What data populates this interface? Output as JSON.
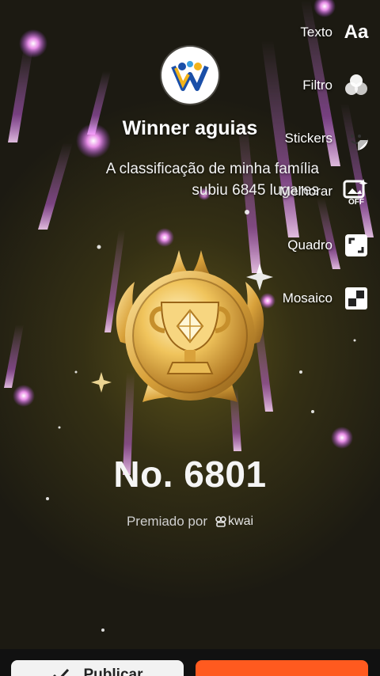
{
  "user": {
    "name": "Winner aguias",
    "rank_line1": "A classificação de minha família",
    "rank_line2": "subiu 6845 lugares"
  },
  "rank": {
    "number": "No. 6801",
    "awarded_by": "Premiado por",
    "brand": "kwai"
  },
  "tools": [
    {
      "label": "Texto",
      "icon": "text-aa-icon",
      "glyph": "Aa"
    },
    {
      "label": "Filtro",
      "icon": "filter-circles-icon"
    },
    {
      "label": "Stickers",
      "icon": "sticker-smile-icon"
    },
    {
      "label": "Melhorar",
      "icon": "enhance-off-icon",
      "badge": "OFF"
    },
    {
      "label": "Quadro",
      "icon": "frame-expand-icon"
    },
    {
      "label": "Mosaico",
      "icon": "mosaic-icon"
    }
  ],
  "bottom": {
    "publish_label": "Publicar"
  },
  "colors": {
    "accent": "#ff5a1f",
    "streak": "#e070ff",
    "gold": "#e8b94a"
  }
}
